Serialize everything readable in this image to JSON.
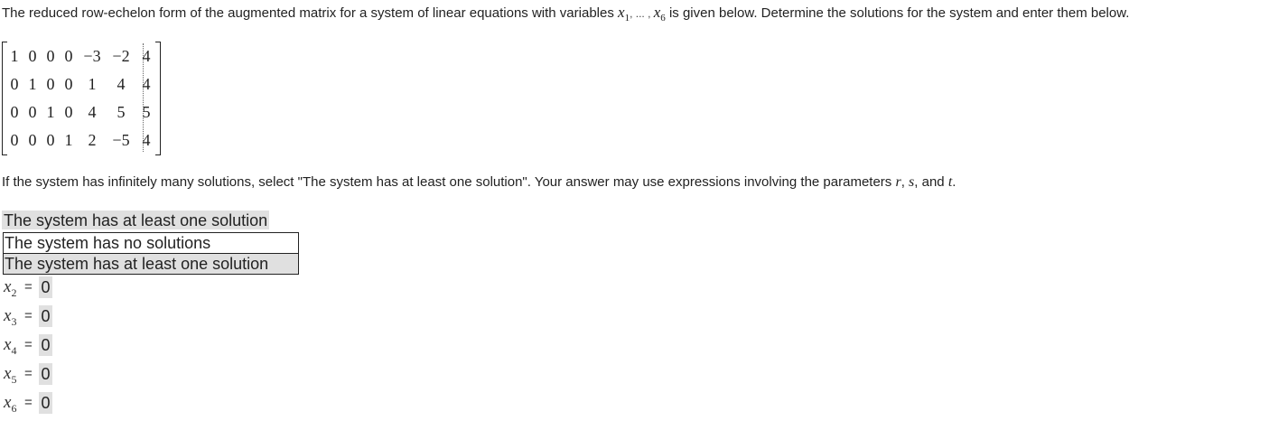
{
  "prompt": {
    "text_before": "The reduced row-echelon form of the augmented matrix for a system of linear equations with variables ",
    "var1": "x",
    "var1_sub": "1",
    "ellipsis": ", ... , ",
    "var2": "x",
    "var2_sub": "6",
    "text_after": " is given below. Determine the solutions for the system and enter them below."
  },
  "matrix": {
    "rows": [
      [
        "1",
        "0",
        "0",
        "0",
        "−3",
        "−2",
        "4"
      ],
      [
        "0",
        "1",
        "0",
        "0",
        "1",
        "4",
        "4"
      ],
      [
        "0",
        "0",
        "1",
        "0",
        "4",
        "5",
        "5"
      ],
      [
        "0",
        "0",
        "0",
        "1",
        "2",
        "−5",
        "4"
      ]
    ]
  },
  "instructions": {
    "text_before": "If the system has infinitely many solutions, select \"The system has at least one solution\". Your answer may use expressions involving the parameters ",
    "p1": "r",
    "sep1": ", ",
    "p2": "s",
    "sep2": ", and ",
    "p3": "t",
    "end": "."
  },
  "select": {
    "selected_value": "The system has at least one solution",
    "options": [
      "The system has no solutions",
      "The system has at least one solution"
    ]
  },
  "answers": [
    {
      "var": "x",
      "sub": "2",
      "eq": "=",
      "value": "0"
    },
    {
      "var": "x",
      "sub": "3",
      "eq": "=",
      "value": "0"
    },
    {
      "var": "x",
      "sub": "4",
      "eq": "=",
      "value": "0"
    },
    {
      "var": "x",
      "sub": "5",
      "eq": "=",
      "value": "0"
    },
    {
      "var": "x",
      "sub": "6",
      "eq": "=",
      "value": "0"
    }
  ],
  "colors": {
    "highlight": "#e0e0e0",
    "text": "#222222",
    "border": "#222222"
  }
}
